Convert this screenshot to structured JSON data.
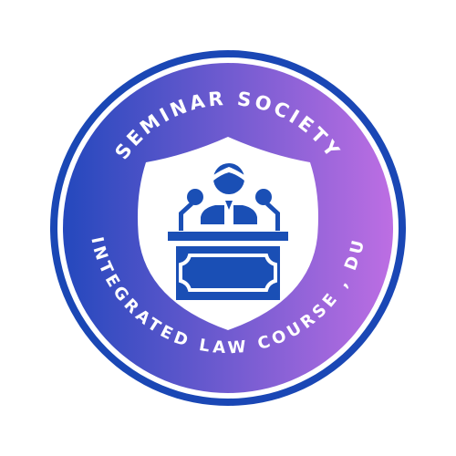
{
  "badge": {
    "top_text": "SEMINAR SOCIETY",
    "bottom_text": "INTEGRATED LAW COURSE , DU",
    "icon": "speaker-at-podium-icon",
    "colors": {
      "ring": "#1a47b5",
      "gradient_start": "#2448bd",
      "gradient_end": "#bd6ee3",
      "icon": "#1a4fb5",
      "shield": "#ffffff"
    }
  }
}
